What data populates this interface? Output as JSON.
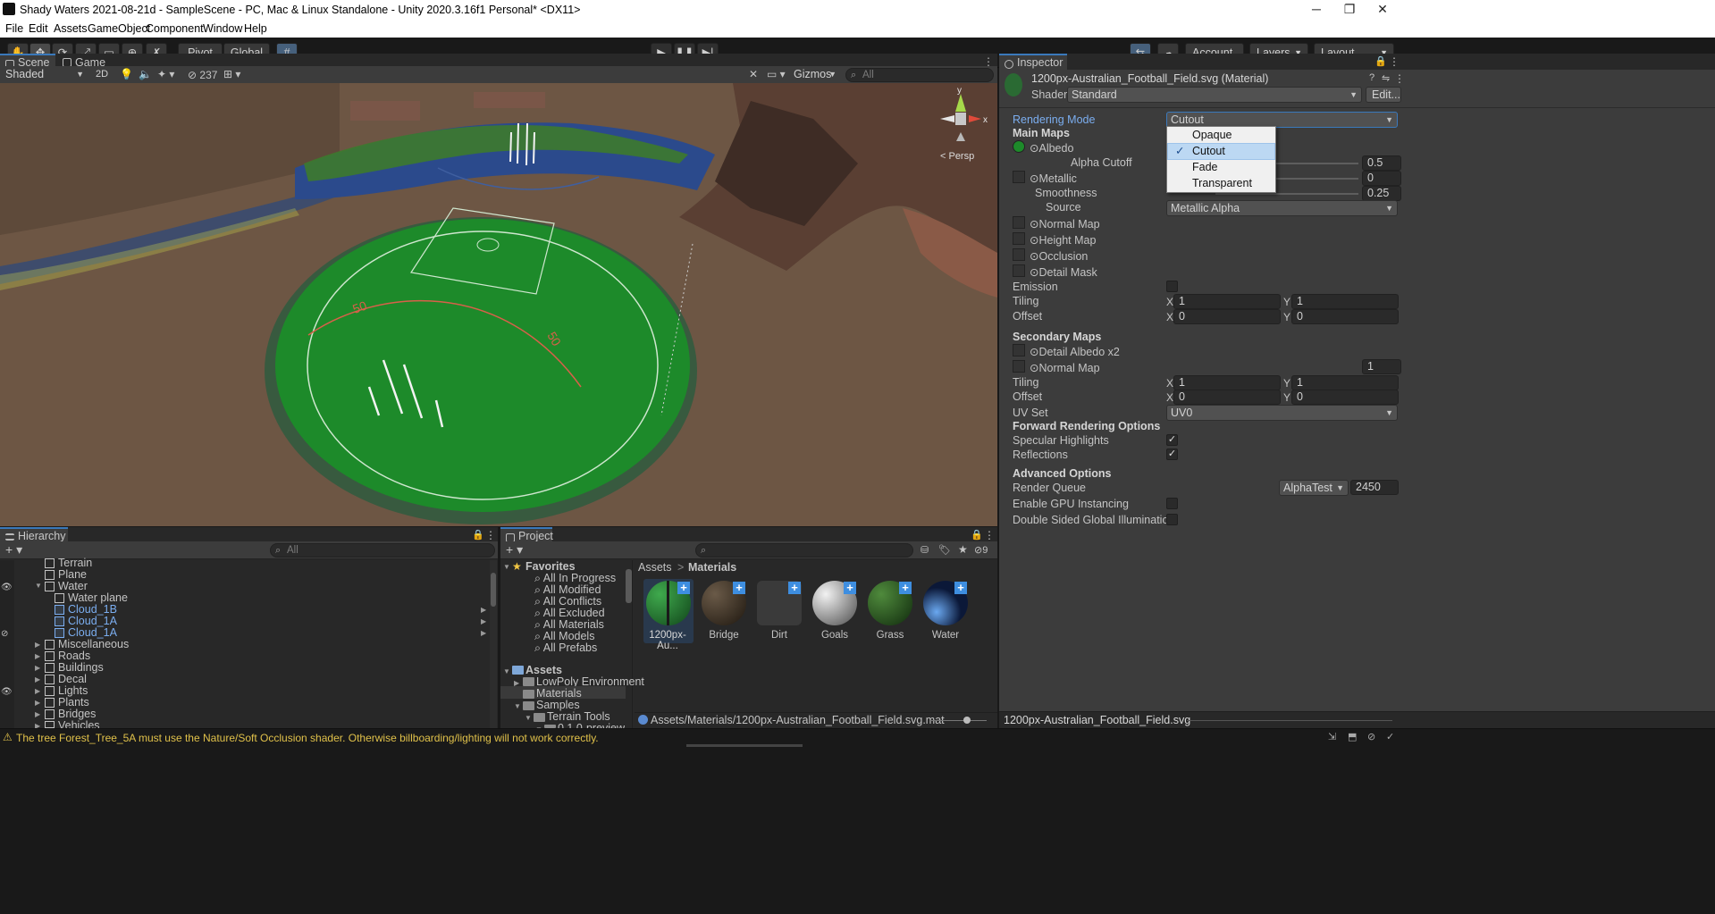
{
  "window": {
    "title": "Shady Waters 2021-08-21d - SampleScene - PC, Mac & Linux Standalone - Unity 2020.3.16f1 Personal* <DX11>",
    "min": "─",
    "max": "❐",
    "close": "✕"
  },
  "menu": [
    "File",
    "Edit",
    "Assets",
    "GameObject",
    "Component",
    "Window",
    "Help"
  ],
  "toolbar": {
    "pivot": "Pivot",
    "global": "Global",
    "account": "Account",
    "layers": "Layers",
    "layout": "Layout"
  },
  "scene_panel": {
    "tabs": [
      "Scene",
      "Game"
    ],
    "shading": "Shaded",
    "mode2d": "2D",
    "hidden_count": "237",
    "gizmos": "Gizmos",
    "search_placeholder": "All",
    "persp": "< Persp",
    "field_markings": [
      "50",
      "50"
    ]
  },
  "inspector": {
    "tab": "Inspector",
    "material_name": "1200px-Australian_Football_Field.svg (Material)",
    "shader_label": "Shader",
    "shader_value": "Standard",
    "edit_button": "Edit...",
    "rendering_mode_label": "Rendering Mode",
    "rendering_mode_value": "Cutout",
    "main_maps": "Main Maps",
    "albedo": "Albedo",
    "alpha_cutoff": "Alpha Cutoff",
    "alpha_cutoff_value": "0.5",
    "metallic": "Metallic",
    "metallic_value": "0",
    "smoothness": "Smoothness",
    "smoothness_value": "0.25",
    "source": "Source",
    "source_value": "Metallic Alpha",
    "normal_map": "Normal Map",
    "height_map": "Height Map",
    "occlusion": "Occlusion",
    "detail_mask": "Detail Mask",
    "emission": "Emission",
    "tiling": "Tiling",
    "offset": "Offset",
    "x": "X",
    "y": "Y",
    "main_tiling_x": "1",
    "main_tiling_y": "1",
    "main_offset_x": "0",
    "main_offset_y": "0",
    "secondary_maps": "Secondary Maps",
    "detail_albedo": "Detail Albedo x2",
    "sec_normal_map": "Normal Map",
    "sec_normal_value": "1",
    "sec_tiling_x": "1",
    "sec_tiling_y": "1",
    "sec_offset_x": "0",
    "sec_offset_y": "0",
    "uv_set": "UV Set",
    "uv_set_value": "UV0",
    "forward_rendering": "Forward Rendering Options",
    "specular_highlights": "Specular Highlights",
    "reflections": "Reflections",
    "advanced_options": "Advanced Options",
    "render_queue": "Render Queue",
    "render_queue_mode": "AlphaTest",
    "render_queue_value": "2450",
    "gpu_instancing": "Enable GPU Instancing",
    "double_sided_gi": "Double Sided Global Illumination",
    "preview_name": "1200px-Australian_Football_Field.svg"
  },
  "rendering_mode_popup": {
    "options": [
      "Opaque",
      "Cutout",
      "Fade",
      "Transparent"
    ],
    "selected": "Cutout",
    "check": "✓"
  },
  "hierarchy": {
    "tab": "Hierarchy",
    "search_placeholder": "All",
    "items": [
      "Terrain",
      "Plane",
      "Water",
      "Water plane",
      "Cloud_1B",
      "Cloud_1A",
      "Cloud_1A",
      "Miscellaneous",
      "Roads",
      "Buildings",
      "Decal",
      "Lights",
      "Plants",
      "Bridges",
      "Vehicles"
    ]
  },
  "project": {
    "tab": "Project",
    "hidden_count": "9",
    "favorites": "Favorites",
    "favorite_items": [
      "All In Progress",
      "All Modified",
      "All Conflicts",
      "All Excluded",
      "All Materials",
      "All Models",
      "All Prefabs"
    ],
    "assets_root": "Assets",
    "asset_folders": [
      "LowPoly Environment",
      "Materials",
      "Samples",
      "Terrain Tools",
      "0.1.0-preview"
    ],
    "breadcrumb_root": "Assets",
    "breadcrumb_sep": ">",
    "breadcrumb_current": "Materials",
    "materials": [
      "1200px-Au...",
      "Bridge",
      "Dirt",
      "Goals",
      "Grass",
      "Water"
    ],
    "selected_path": "Assets/Materials/1200px-Australian_Football_Field.svg.mat"
  },
  "status": {
    "warning": "The tree Forest_Tree_5A must use the Nature/Soft Occlusion shader. Otherwise billboarding/lighting will not work correctly.",
    "warning_icon": "⚠"
  },
  "colors": {
    "accent": "#3a79bb",
    "selected_text": "#7baef0",
    "field_green": "#1d8a2a",
    "ground_brown": "#6d5644"
  }
}
